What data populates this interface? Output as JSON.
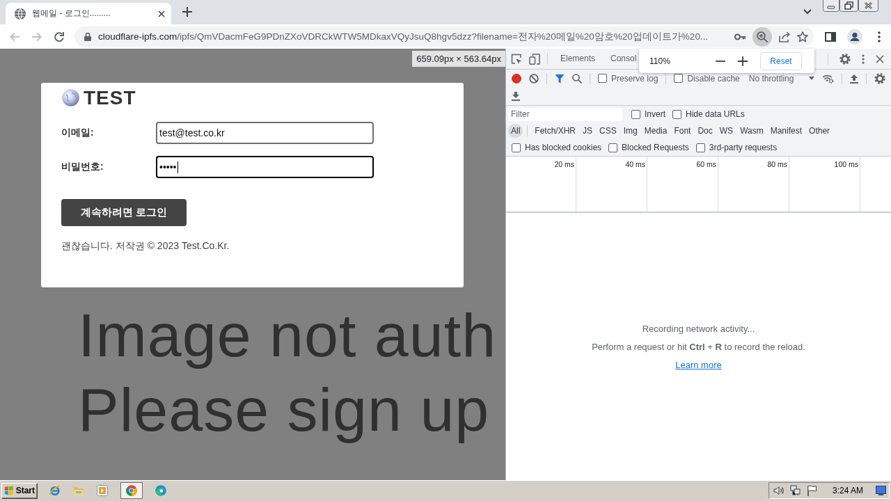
{
  "browser": {
    "tabs": [
      {
        "title": "웹메일 - 로그인.........",
        "selected": true
      }
    ],
    "nav": [
      {
        "kind": "back",
        "disabled": true
      },
      {
        "kind": "forward",
        "disabled": true
      },
      {
        "kind": "reload",
        "disabled": false
      }
    ],
    "address": {
      "host": "cloudflare-ipfs.com",
      "path": "/ipfs/QmVDacmFeG9PDnZXoVDRCkWTW5MDkaxVQyJsuQ8hgv5dzz?filename=전자%20메일%20암호%20업데이트가%20..."
    },
    "omnibox_icons": [
      {
        "kind": "key",
        "active": false
      },
      {
        "kind": "zoom",
        "active": true
      },
      {
        "kind": "share",
        "active": false
      },
      {
        "kind": "star",
        "active": false
      }
    ],
    "zoom_popup": {
      "zoom_text": "110%",
      "reset": "Reset"
    }
  },
  "page": {
    "size_overlay": "659.09px × 563.64px",
    "logo": "TEST",
    "fields": [
      {
        "label": "이메일:",
        "value": "test@test.co.kr",
        "focused": false
      },
      {
        "label": "비밀번호:",
        "value": "•••••",
        "focused": true
      }
    ],
    "submit": "계속하려면 로그인",
    "footer": "괜찮습니다. 저작권 © 2023 Test.Co.Kr.",
    "image_text": [
      "Image not auth",
      "Please sign up"
    ]
  },
  "devtools": {
    "tabs": [
      {
        "label": "Elements",
        "selected": false
      },
      {
        "label": "Consol",
        "selected": false
      }
    ],
    "recording": true,
    "toolbar_options": [
      {
        "label": "Preserve log",
        "checked": false
      },
      {
        "label": "Disable cache",
        "checked": false
      }
    ],
    "throttling": "No throttling",
    "filter": {
      "placeholder": "Filter",
      "options": [
        {
          "label": "Invert",
          "checked": false
        },
        {
          "label": "Hide data URLs",
          "checked": false
        }
      ]
    },
    "types": [
      {
        "label": "All",
        "selected": true
      },
      {
        "label": "Fetch/XHR",
        "selected": false
      },
      {
        "label": "JS",
        "selected": false
      },
      {
        "label": "CSS",
        "selected": false
      },
      {
        "label": "Img",
        "selected": false
      },
      {
        "label": "Media",
        "selected": false
      },
      {
        "label": "Font",
        "selected": false
      },
      {
        "label": "Doc",
        "selected": false
      },
      {
        "label": "WS",
        "selected": false
      },
      {
        "label": "Wasm",
        "selected": false
      },
      {
        "label": "Manifest",
        "selected": false
      },
      {
        "label": "Other",
        "selected": false
      }
    ],
    "request_options": [
      {
        "label": "Has blocked cookies",
        "checked": false
      },
      {
        "label": "Blocked Requests",
        "checked": false
      },
      {
        "label": "3rd-party requests",
        "checked": false
      }
    ],
    "timeline_ticks": [
      "20 ms",
      "40 ms",
      "60 ms",
      "80 ms",
      "100 ms"
    ],
    "empty": {
      "title": "Recording network activity...",
      "hint": "Perform a request or hit **Ctrl** + **R** to record the reload.",
      "link": "Learn more"
    }
  },
  "taskbar": {
    "start": "Start",
    "apps": [
      {
        "kind": "ie",
        "selected": false
      },
      {
        "kind": "folder",
        "selected": false
      },
      {
        "kind": "media",
        "selected": false
      },
      {
        "kind": "chrome",
        "selected": true
      },
      {
        "kind": "edge",
        "selected": false
      }
    ],
    "clock": "3:24 AM"
  }
}
